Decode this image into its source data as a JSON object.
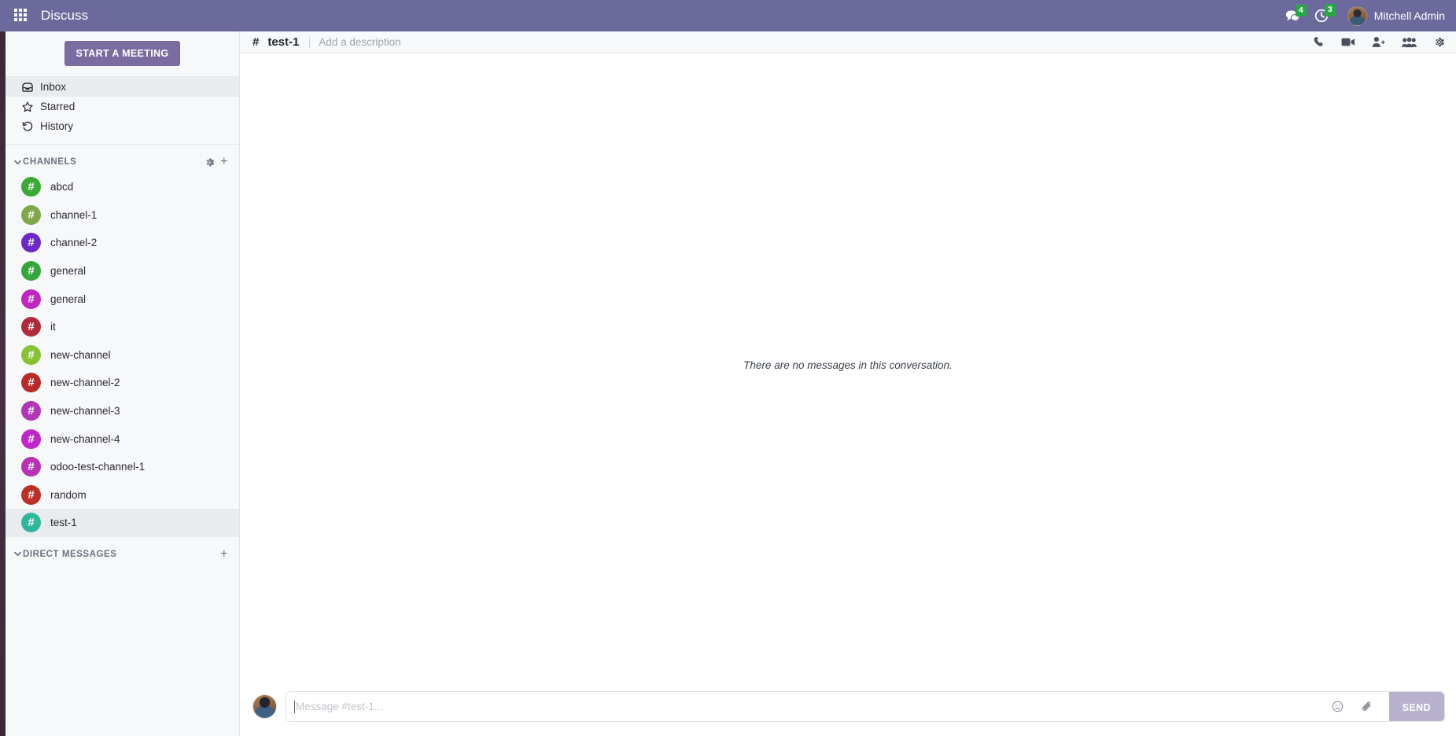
{
  "navbar": {
    "apps_icon": "apps-grid-icon",
    "brand": "Discuss",
    "messages_icon": "chat-bubble-icon",
    "messages_count": "4",
    "activities_icon": "clock-icon",
    "activities_count": "3",
    "user_name": "Mitchell Admin",
    "brand_color": "#6c6a9c",
    "badge_color": "#28a745"
  },
  "sidebar": {
    "start_meeting_label": "START A MEETING",
    "mailboxes": [
      {
        "label": "Inbox",
        "icon": "inbox-icon",
        "active": true
      },
      {
        "label": "Starred",
        "icon": "star-icon",
        "active": false
      },
      {
        "label": "History",
        "icon": "history-icon",
        "active": false
      }
    ],
    "channels_section": {
      "title": "CHANNELS",
      "caret_icon": "chevron-down-icon",
      "settings_icon": "gear-icon",
      "add_icon": "plus-icon"
    },
    "channels": [
      {
        "name": "abcd",
        "color": "#3aaa35",
        "active": false
      },
      {
        "name": "channel-1",
        "color": "#7fa84a",
        "active": false
      },
      {
        "name": "channel-2",
        "color": "#6a29c4",
        "active": false
      },
      {
        "name": "general",
        "color": "#34a63a",
        "active": false
      },
      {
        "name": "general",
        "color": "#c026c0",
        "active": false
      },
      {
        "name": "it",
        "color": "#b02a3c",
        "active": false
      },
      {
        "name": "new-channel",
        "color": "#86c232",
        "active": false
      },
      {
        "name": "new-channel-2",
        "color": "#b92a28",
        "active": false
      },
      {
        "name": "new-channel-3",
        "color": "#b335b8",
        "active": false
      },
      {
        "name": "new-channel-4",
        "color": "#c026c8",
        "active": false
      },
      {
        "name": "odoo-test-channel-1",
        "color": "#b832b8",
        "active": false
      },
      {
        "name": "random",
        "color": "#bb2f28",
        "active": false
      },
      {
        "name": "test-1",
        "color": "#2fb79b",
        "active": true
      }
    ],
    "direct_messages_section": {
      "title": "DIRECT MESSAGES",
      "caret_icon": "chevron-down-icon",
      "add_icon": "plus-icon"
    },
    "hash_glyph": "#"
  },
  "thread": {
    "hash": "#",
    "title": "test-1",
    "description_placeholder": "Add a description",
    "actions": [
      {
        "icon": "phone-icon",
        "name": "start-call-button"
      },
      {
        "icon": "video-icon",
        "name": "start-video-call-button"
      },
      {
        "icon": "add-user-icon",
        "name": "invite-people-button"
      },
      {
        "icon": "members-icon",
        "name": "show-members-button"
      },
      {
        "icon": "gear-icon",
        "name": "thread-settings-button"
      }
    ],
    "empty_message": "There are no messages in this conversation."
  },
  "composer": {
    "placeholder": "Message #test-1...",
    "value": "",
    "emoji_icon": "emoji-icon",
    "attachment_icon": "paperclip-icon",
    "send_label": "SEND",
    "send_color": "#b8b2cf"
  }
}
